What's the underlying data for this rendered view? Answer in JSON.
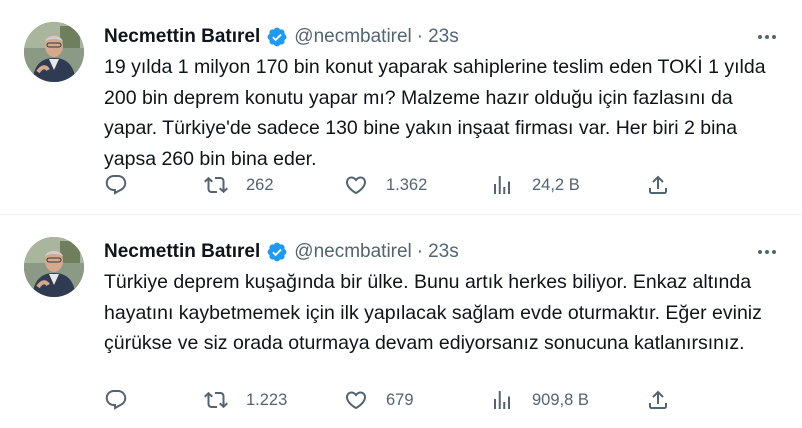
{
  "tweets": [
    {
      "author_name": "Necmettin Batırel",
      "handle": "@necmbatirel",
      "separator": "·",
      "time": "23s",
      "text": "19 yılda 1 milyon 170 bin konut yaparak sahiplerine teslim eden TOKİ 1 yılda 200 bin deprem konutu yapar mı? Malzeme hazır olduğu için fazlasını da yapar. Türkiye'de sadece 130 bine yakın inşaat firması var. Her biri 2 bina yapsa 260 bin bina eder.",
      "retweets": "262",
      "likes": "1.362",
      "views": "24,2 B"
    },
    {
      "author_name": "Necmettin Batırel",
      "handle": "@necmbatirel",
      "separator": "·",
      "time": "23s",
      "text": "Türkiye deprem kuşağında bir ülke. Bunu artık herkes biliyor. Enkaz altında hayatını kaybetmemek için ilk yapılacak sağlam evde oturmaktır. Eğer eviniz çürükse ve siz orada oturmaya devam ediyorsanız sonucuna katlanırsınız.",
      "retweets": "1.223",
      "likes": "679",
      "views": "909,8 B"
    }
  ],
  "icons": {
    "verified": "verified-badge-icon",
    "more": "more-dots-icon",
    "reply": "reply-bubble-icon",
    "retweet": "retweet-icon",
    "like": "heart-icon",
    "views": "views-bar-icon",
    "share": "share-upload-icon"
  },
  "colors": {
    "verified_blue": "#1d9bf0",
    "secondary_text": "#536471",
    "primary_text": "#0f1419",
    "divider": "#eff3f4"
  }
}
